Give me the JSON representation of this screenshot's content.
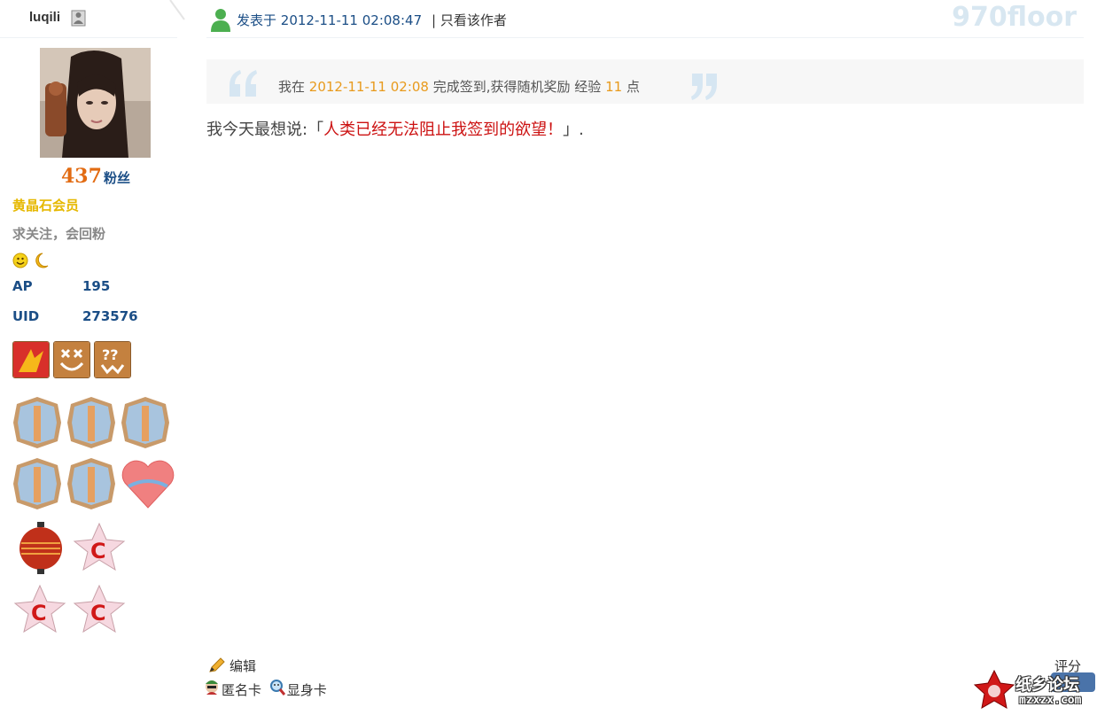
{
  "user": {
    "username": "luqili",
    "fans_count": "437",
    "fans_label": "粉丝",
    "group": "黄晶石会员",
    "signature": "求关注，会回粉",
    "stats": [
      {
        "label": "AP",
        "value": "195"
      },
      {
        "label": "UID",
        "value": "273576"
      }
    ]
  },
  "post": {
    "posted_prefix": "发表于",
    "posted_time": "2012-11-11 02:08:47",
    "only_author": "| 只看该作者",
    "floor": "970floor",
    "signin": {
      "prefix": "我在",
      "time": "2012-11-11 02:08",
      "middle": "完成签到,获得随机奖励 经验",
      "exp": "11",
      "suffix": "点"
    },
    "body_prefix": "我今天最想说:「",
    "body_quote": "人类已经无法阻止我签到的欲望！",
    "body_suffix": "」."
  },
  "actions": {
    "edit": "编辑",
    "rate": "评分",
    "anon_card": "匿名卡",
    "reveal_card": "显身卡"
  },
  "watermark": {
    "site_name": "纸乡论坛",
    "domain": "mzxzx.com"
  },
  "colors": {
    "link_blue": "#1b4e86",
    "orange": "#e26b12",
    "gold": "#e6b800",
    "highlight": "#e89a1c",
    "red": "#cc1111"
  }
}
